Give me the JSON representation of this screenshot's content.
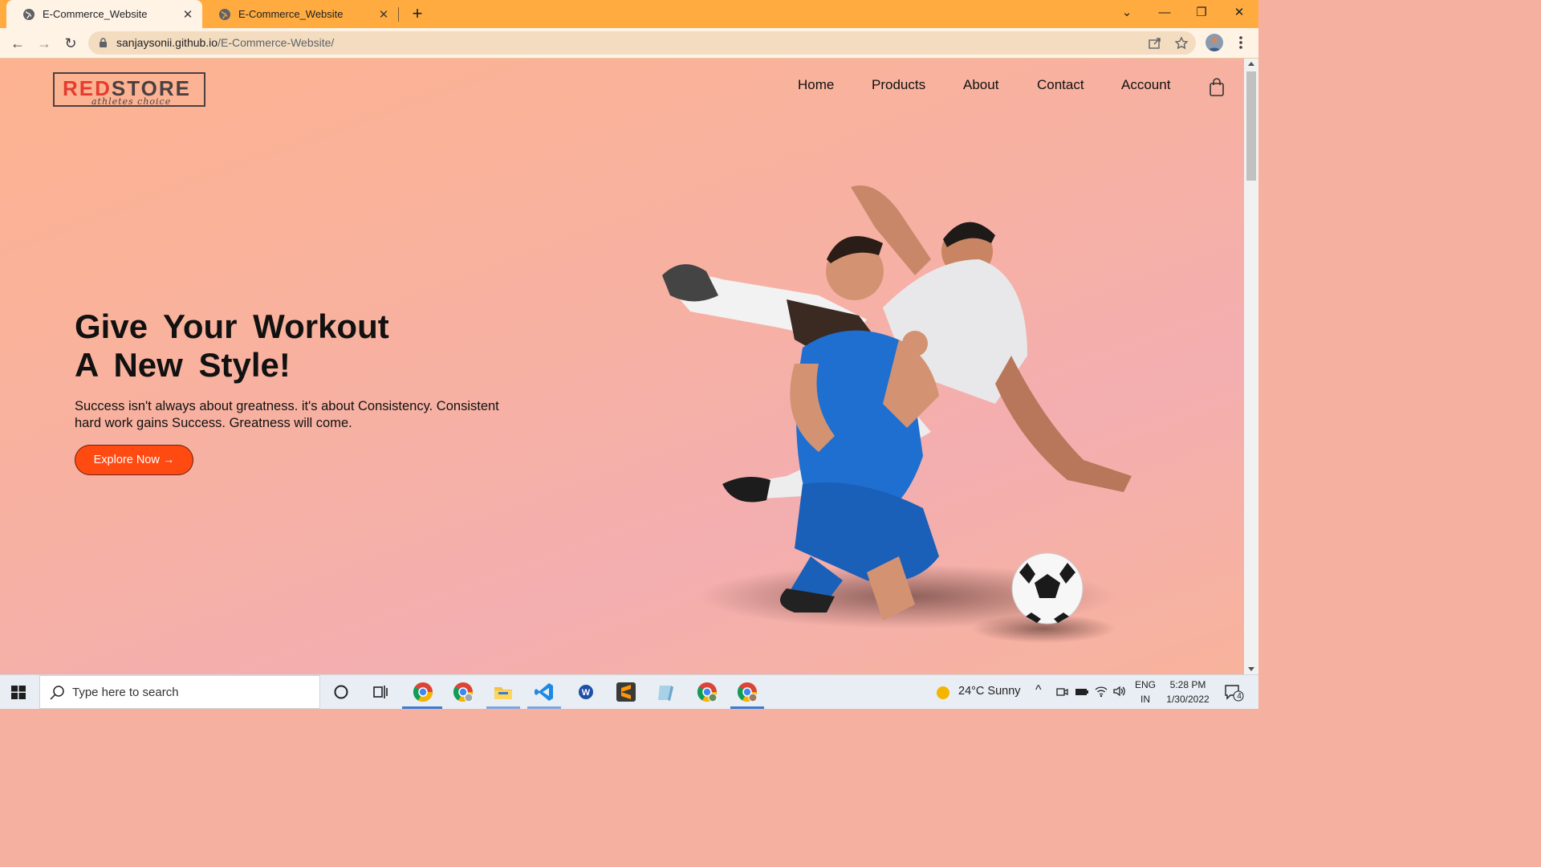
{
  "browser": {
    "tabs": [
      {
        "title": "E-Commerce_Website",
        "active": true
      },
      {
        "title": "E-Commerce_Website",
        "active": false
      }
    ],
    "url_host": "sanjaysonii.github.io",
    "url_path": "/E-Commerce-Website/"
  },
  "site": {
    "logo_main_red": "RED",
    "logo_main_dark": "STORE",
    "logo_tagline": "athletes choice",
    "nav": [
      "Home",
      "Products",
      "About",
      "Contact",
      "Account"
    ],
    "hero": {
      "title_line1": "Give Your Workout",
      "title_line2": "A New Style!",
      "text": "Success isn't always about greatness. it's about Consistency. Consistent hard work gains Success. Greatness will come.",
      "button": "Explore Now →"
    },
    "colors": {
      "accent": "#ff4a12",
      "tabbar": "#ffab3f"
    }
  },
  "taskbar": {
    "search_placeholder": "Type here to search",
    "weather": "24°C  Sunny",
    "lang_line1": "ENG",
    "lang_line2": "IN",
    "time": "5:28 PM",
    "date": "1/30/2022",
    "notifications": "4"
  }
}
